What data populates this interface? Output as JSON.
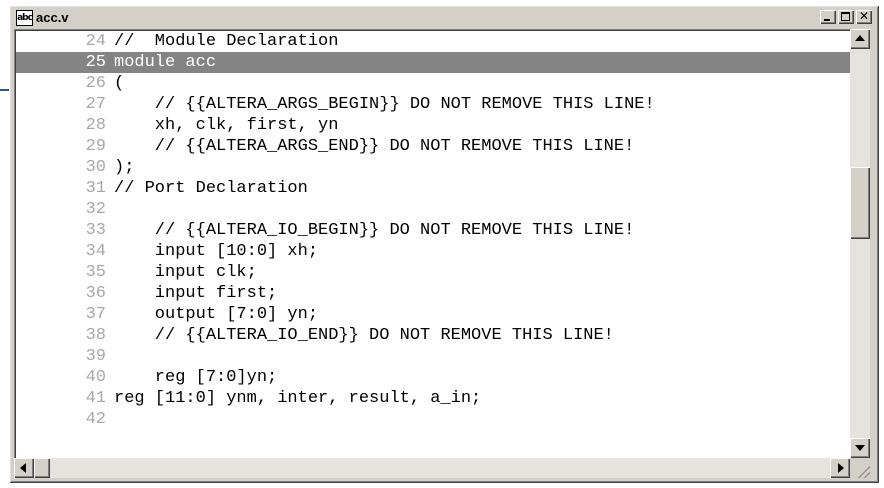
{
  "window": {
    "title": "acc.v",
    "icon_label": "abc",
    "icon": "text-file-icon"
  },
  "controls": {
    "minimize": "minimize-icon",
    "maximize": "maximize-icon",
    "close_glyph": "✕"
  },
  "colors": {
    "selection_bg": "#848484",
    "line_number": "#a8a8a8",
    "callout": "#2a55a5"
  },
  "lines": [
    {
      "num": "24",
      "code": "//  Module Declaration"
    },
    {
      "num": "25",
      "code": "module acc",
      "selected": true
    },
    {
      "num": "26",
      "code": "("
    },
    {
      "num": "27",
      "code": "    // {{ALTERA_ARGS_BEGIN}} DO NOT REMOVE THIS LINE!"
    },
    {
      "num": "28",
      "code": "    xh, clk, first, yn"
    },
    {
      "num": "29",
      "code": "    // {{ALTERA_ARGS_END}} DO NOT REMOVE THIS LINE!"
    },
    {
      "num": "30",
      "code": ");"
    },
    {
      "num": "31",
      "code": "// Port Declaration"
    },
    {
      "num": "32",
      "code": ""
    },
    {
      "num": "33",
      "code": "    // {{ALTERA_IO_BEGIN}} DO NOT REMOVE THIS LINE!"
    },
    {
      "num": "34",
      "code": "    input [10:0] xh;"
    },
    {
      "num": "35",
      "code": "    input clk;"
    },
    {
      "num": "36",
      "code": "    input first;"
    },
    {
      "num": "37",
      "code": "    output [7:0] yn;"
    },
    {
      "num": "38",
      "code": "    // {{ALTERA_IO_END}} DO NOT REMOVE THIS LINE!"
    },
    {
      "num": "39",
      "code": ""
    },
    {
      "num": "40",
      "code": "    reg [7:0]yn;"
    },
    {
      "num": "41",
      "code": "reg [11:0] ynm, inter, result, a_in;"
    },
    {
      "num": "42",
      "code": ""
    }
  ]
}
